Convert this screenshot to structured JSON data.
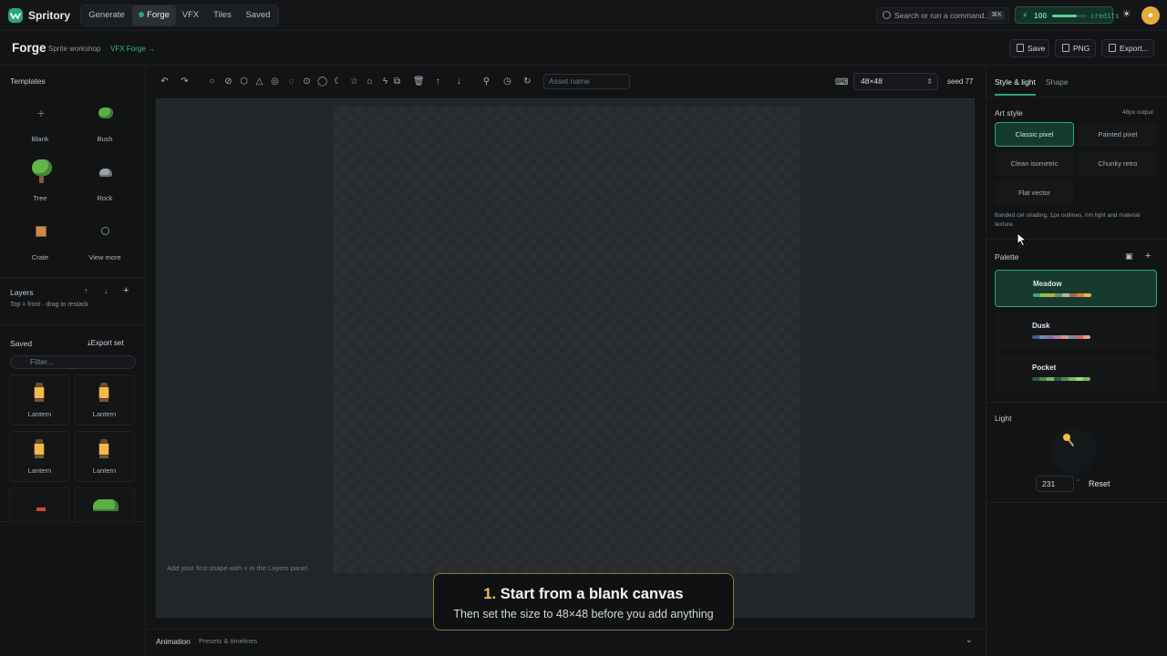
{
  "app": {
    "name": "Spritory"
  },
  "nav": [
    {
      "label": "Generate"
    },
    {
      "label": "Forge"
    },
    {
      "label": "VFX"
    },
    {
      "label": "Tiles"
    },
    {
      "label": "Saved"
    }
  ],
  "command": {
    "placeholder": "Search or run a command...",
    "shortcut": "⌘K"
  },
  "credits": {
    "value": "100",
    "label": "credits",
    "level": 0.7
  },
  "header": {
    "title": "Forge",
    "subtitle": "Sprite workshop",
    "link": "VFX Forge →"
  },
  "actions": {
    "save": "Save",
    "png": "PNG",
    "export": "Export..."
  },
  "templates": {
    "title": "Templates",
    "items": [
      {
        "label": "Blank"
      },
      {
        "label": "Bush"
      },
      {
        "label": "Tree"
      },
      {
        "label": "Rock"
      },
      {
        "label": "Crate"
      },
      {
        "label": "View more"
      }
    ]
  },
  "layers": {
    "title": "Layers",
    "hint": "Top = front · drag to restack"
  },
  "saved": {
    "title": "Saved",
    "export_set": "Export set",
    "filter_placeholder": "Filter...",
    "items": [
      {
        "label": "Lantern"
      },
      {
        "label": "Lantern"
      },
      {
        "label": "Lantern"
      },
      {
        "label": "Lantern"
      }
    ]
  },
  "toolbar": {
    "asset_placeholder": "Asset name",
    "size": "48×48",
    "seed": "seed 77"
  },
  "canvas": {
    "hint": "Add your first shape with + in the Layers panel."
  },
  "animation": {
    "title": "Animation",
    "subtitle": "Presets & timelines"
  },
  "right": {
    "tabs": [
      {
        "label": "Style & light"
      },
      {
        "label": "Shape"
      }
    ],
    "art_style": {
      "title": "Art style",
      "output": "48px output",
      "options": [
        {
          "label": "Classic pixel",
          "selected": true
        },
        {
          "label": "Painted pixel",
          "selected": false
        },
        {
          "label": "Clean isometric",
          "selected": false
        },
        {
          "label": "Chunky retro",
          "selected": false
        },
        {
          "label": "Flat vector",
          "selected": false
        }
      ],
      "description": "Banded cel shading, 1px outlines, rim light and material texture."
    },
    "palette": {
      "title": "Palette",
      "items": [
        {
          "name": "Meadow",
          "selected": true,
          "colors": [
            "#4aa36b",
            "#8bc34a",
            "#c9a24a",
            "#6e8b6a",
            "#b8b1a0",
            "#9c6b4a",
            "#e07a4a",
            "#f0b24a"
          ]
        },
        {
          "name": "Dusk",
          "selected": false,
          "colors": [
            "#3c5a8a",
            "#6b8bb8",
            "#8a6ba8",
            "#b87a9a",
            "#d99a8a",
            "#7a8aa8",
            "#c96a6a",
            "#e0a07a"
          ]
        },
        {
          "name": "Pocket",
          "selected": false,
          "colors": [
            "#2f5a3a",
            "#4a8a4a",
            "#7ab85a",
            "#2f5a3a",
            "#4a8a4a",
            "#7ab85a",
            "#a6d86a",
            "#7ab85a"
          ]
        }
      ]
    },
    "light": {
      "title": "Light",
      "angle": "231",
      "unit": "°",
      "reset": "Reset"
    }
  },
  "toast": {
    "step": "1.",
    "title": "Start from a blank canvas",
    "body": "Then set the size to 48×48 before you add anything"
  }
}
